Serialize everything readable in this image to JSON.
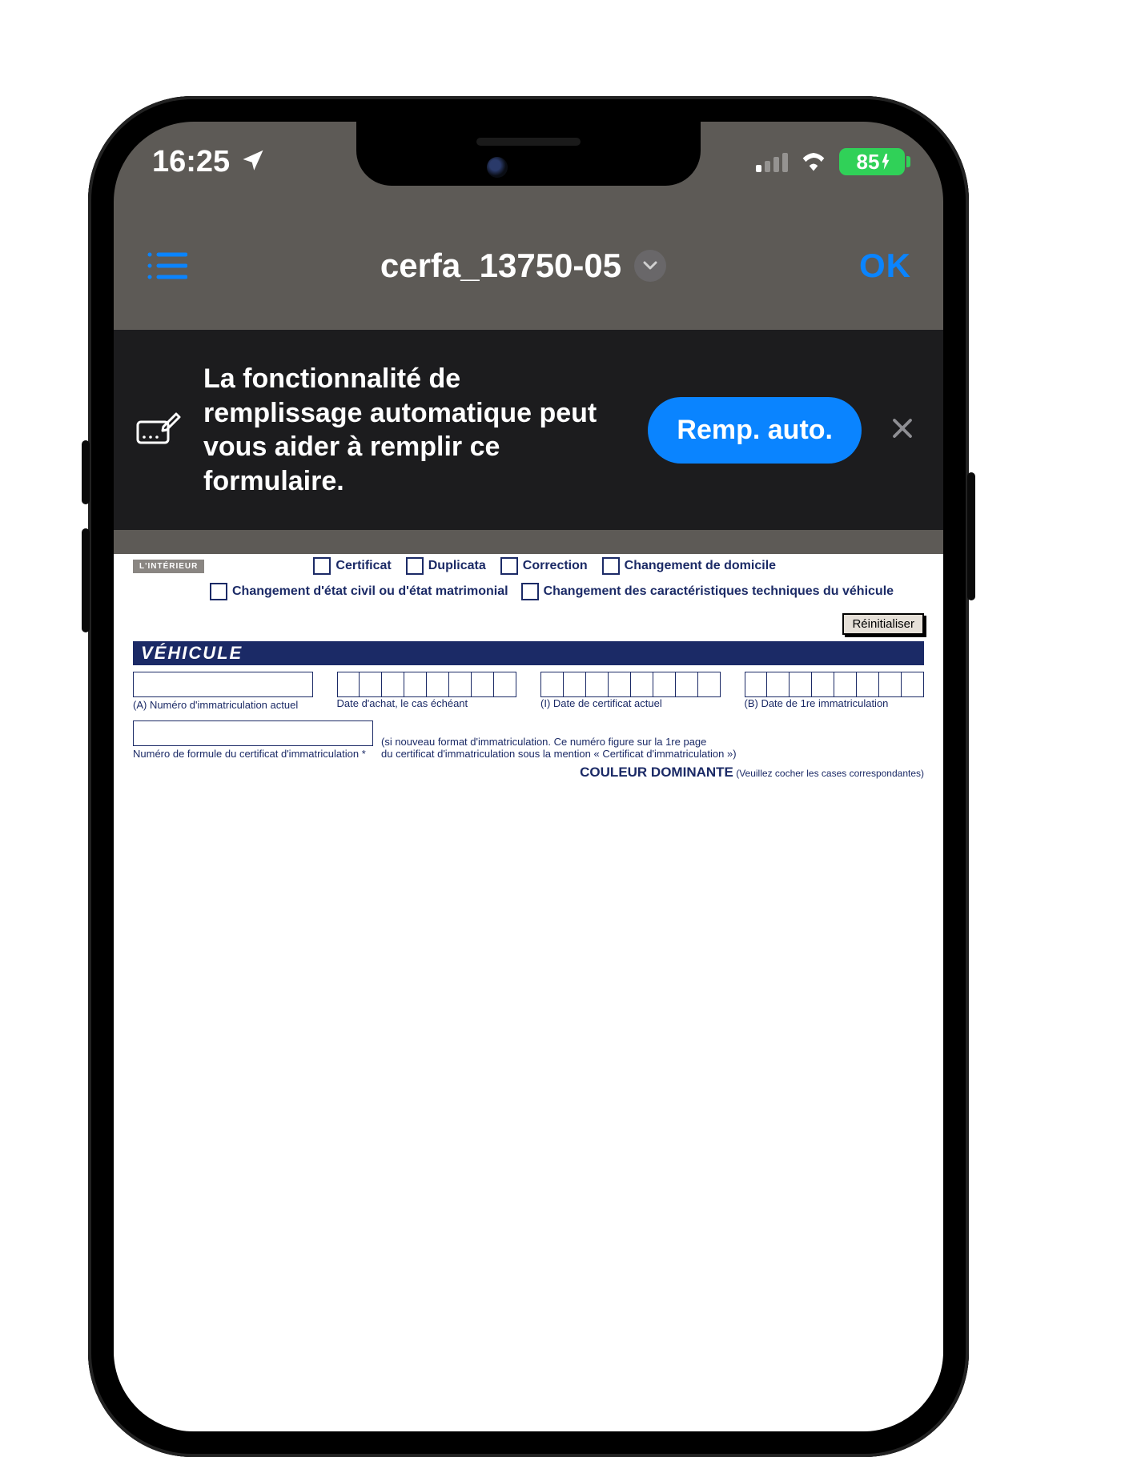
{
  "status": {
    "time": "16:25",
    "battery_pct": "85"
  },
  "navbar": {
    "title": "cerfa_13750-05",
    "ok": "OK"
  },
  "banner": {
    "text": "La fonctionnalité de remplissage automatique peut vous aider à remplir ce formulaire.",
    "button": "Remp. auto."
  },
  "form": {
    "interieur": "L'INTÉRIEUR",
    "opts_row1": {
      "certificat": "Certificat",
      "duplicata": "Duplicata",
      "correction": "Correction",
      "changement_domicile": "Changement de domicile"
    },
    "opts_row2": {
      "etat_civil": "Changement d'état civil ou d'état matrimonial",
      "carac": "Changement des caractéristiques techniques du véhicule"
    },
    "reset": "Réinitialiser",
    "vehicule_header": "VÉHICULE",
    "labels": {
      "a": "(A) Numéro d'immatriculation actuel",
      "date_achat": "Date d'achat, le cas échéant",
      "i": "(I) Date de certificat actuel",
      "b": "(B) Date de 1re immatriculation",
      "formule1": "Numéro de formule du certificat d'immatriculation *",
      "formule_note1": "(si nouveau format d'immatriculation. Ce numéro figure sur la 1re page",
      "formule_note2": "du certificat d'immatriculation sous la mention « Certificat d'immatriculation »)",
      "couleur": "COULEUR DOMINANTE",
      "couleur_note": " (Veuillez cocher les cases correspondantes)"
    }
  }
}
